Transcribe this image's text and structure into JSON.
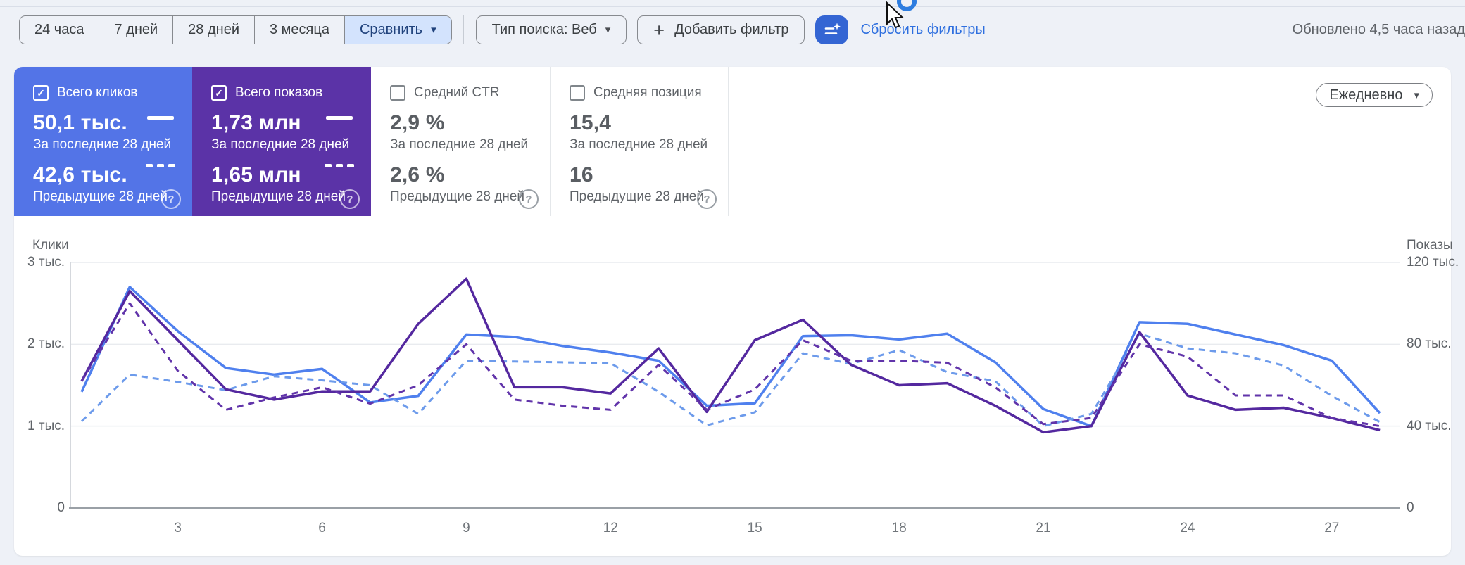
{
  "toolbar": {
    "date_ranges": [
      "24 часа",
      "7 дней",
      "28 дней",
      "3 месяца"
    ],
    "compare_label": "Сравнить",
    "search_type_label": "Тип поиска: Веб",
    "add_filter_label": "Добавить фильтр",
    "reset_filters_label": "Сбросить фильтры",
    "updated_label": "Обновлено 4,5 часа назад"
  },
  "granularity": {
    "label": "Ежедневно"
  },
  "colors": {
    "clicks_card_bg": "#5374e7",
    "impressions_card_bg": "#5b33a7",
    "clicks_line": "#4f80ee",
    "clicks_prev_line": "#6d9beb",
    "impressions_line": "#54289f",
    "impressions_prev_line": "#6134aa",
    "filter_button_bg": "#3465d3",
    "compare_chip_bg": "#d3e3fd",
    "link_blue": "#2e6fdf"
  },
  "metric_cards": [
    {
      "title": "Всего кликов",
      "checked": true,
      "variant": "blue",
      "current": "50,1 тыс.",
      "current_caption": "За последние 28 дней",
      "previous": "42,6 тыс.",
      "previous_caption": "Предыдущие 28 дней"
    },
    {
      "title": "Всего показов",
      "checked": true,
      "variant": "purple",
      "current": "1,73 млн",
      "current_caption": "За последние 28 дней",
      "previous": "1,65 млн",
      "previous_caption": "Предыдущие 28 дней"
    },
    {
      "title": "Средний CTR",
      "checked": false,
      "variant": "plain",
      "current": "2,9 %",
      "current_caption": "За последние 28 дней",
      "previous": "2,6 %",
      "previous_caption": "Предыдущие 28 дней"
    },
    {
      "title": "Средняя позиция",
      "checked": false,
      "variant": "plain",
      "current": "15,4",
      "current_caption": "За последние 28 дней",
      "previous": "16",
      "previous_caption": "Предыдущие 28 дней"
    }
  ],
  "chart_data": {
    "type": "line",
    "x": [
      1,
      2,
      3,
      4,
      5,
      6,
      7,
      8,
      9,
      10,
      11,
      12,
      13,
      14,
      15,
      16,
      17,
      18,
      19,
      20,
      21,
      22,
      23,
      24,
      25,
      26,
      27,
      28
    ],
    "x_ticks": [
      3,
      6,
      9,
      12,
      15,
      18,
      21,
      24,
      27
    ],
    "left_axis": {
      "title": "Клики",
      "ticks": [
        "3 тыс.",
        "2 тыс.",
        "1 тыс.",
        "0"
      ],
      "max": 3000
    },
    "right_axis": {
      "title": "Показы",
      "ticks": [
        "120 тыс.",
        "80 тыс.",
        "40 тыс.",
        "0"
      ],
      "max": 120
    },
    "grid": true,
    "series": [
      {
        "name": "Клики — за последние 28 дней",
        "axis": "left",
        "style": "solid",
        "color": "#4f80ee",
        "values": [
          1420,
          2700,
          2160,
          1710,
          1630,
          1700,
          1290,
          1370,
          2120,
          2090,
          1980,
          1900,
          1800,
          1250,
          1280,
          2100,
          2110,
          2060,
          2130,
          1780,
          1210,
          1000,
          2270,
          2250,
          2120,
          1990,
          1800,
          1160
        ]
      },
      {
        "name": "Клики — предыдущие 28 дней",
        "axis": "left",
        "style": "dashed",
        "color": "#6d9beb",
        "values": [
          1060,
          1630,
          1540,
          1440,
          1610,
          1560,
          1500,
          1150,
          1800,
          1790,
          1780,
          1770,
          1420,
          1010,
          1170,
          1890,
          1760,
          1930,
          1660,
          1550,
          1000,
          1150,
          2130,
          1950,
          1890,
          1740,
          1370,
          1050
        ]
      },
      {
        "name": "Показы (тыс.) — за последние 28 дней",
        "axis": "right",
        "style": "solid",
        "color": "#54289f",
        "values": [
          62,
          106,
          82,
          58,
          53,
          57,
          57,
          90,
          112,
          59,
          59,
          56,
          78,
          47,
          82,
          92,
          70,
          60,
          61,
          50,
          37,
          40,
          86,
          55,
          48,
          49,
          44,
          38
        ]
      },
      {
        "name": "Показы (тыс.) — предыдущие 28 дней",
        "axis": "right",
        "style": "dashed",
        "color": "#6134aa",
        "values": [
          62,
          100,
          67,
          48,
          54,
          59,
          51,
          60,
          80,
          53,
          50,
          48,
          70,
          48,
          58,
          82,
          72,
          72,
          71,
          59,
          41,
          44,
          80,
          74,
          55,
          55,
          44,
          40
        ]
      }
    ]
  }
}
